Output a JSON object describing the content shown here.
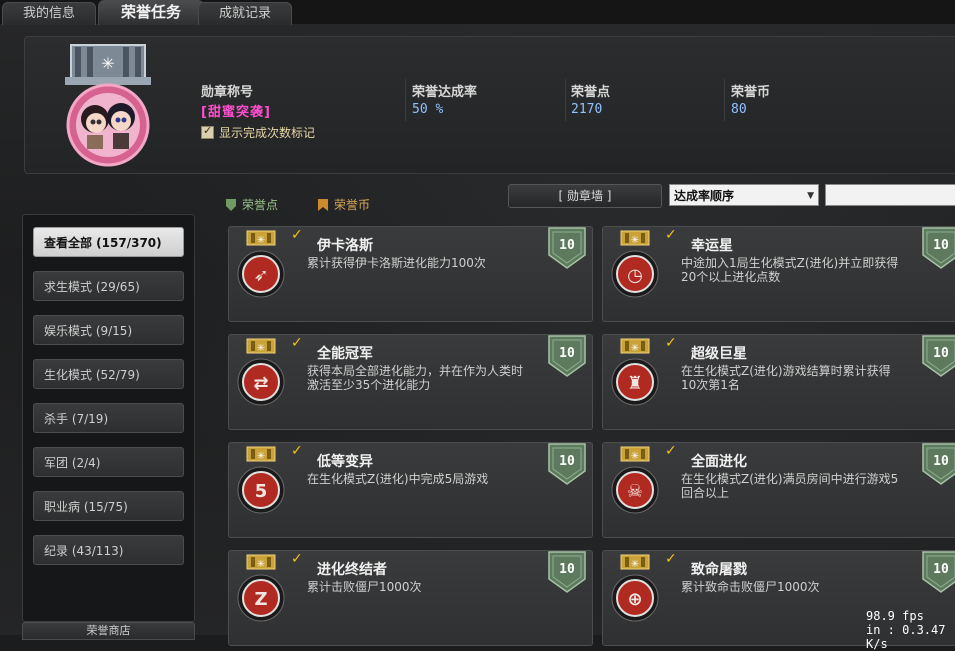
{
  "tabs": [
    {
      "label": "我的信息"
    },
    {
      "label": "荣誉任务"
    },
    {
      "label": "成就记录"
    }
  ],
  "profile": {
    "medal_title_label": "勋章称号",
    "medal_title_value": "[甜蜜突袭]",
    "completion_label": "荣誉达成率",
    "completion_value": "50 %",
    "honor_points_label": "荣誉点",
    "honor_points_value": "2170",
    "honor_coins_label": "荣誉币",
    "honor_coins_value": "80",
    "show_count_label": "显示完成次数标记",
    "show_count_checked": true
  },
  "legend": {
    "honor_points": "荣誉点",
    "honor_coins": "荣誉币"
  },
  "controls": {
    "wall_button": "[ 勋章墙 ]",
    "sort_value": "达成率顺序"
  },
  "sidebar": {
    "items": [
      {
        "label": "查看全部 (157/370)"
      },
      {
        "label": "求生模式 (29/65)"
      },
      {
        "label": "娱乐模式 (9/15)"
      },
      {
        "label": "生化模式 (52/79)"
      },
      {
        "label": "杀手 (7/19)"
      },
      {
        "label": "军团 (2/4)"
      },
      {
        "label": "职业病 (15/75)"
      },
      {
        "label": "纪录 (43/113)"
      }
    ],
    "bottom_label": "荣誉商店"
  },
  "cards": [
    {
      "title": "伊卡洛斯",
      "desc": "累计获得伊卡洛斯进化能力100次",
      "points": "10",
      "icon": "wings-icon"
    },
    {
      "title": "幸运星",
      "desc": "中途加入1局生化模式Z(进化)并立即获得20个以上进化点数",
      "points": "10",
      "icon": "clock-icon"
    },
    {
      "title": "全能冠军",
      "desc": "获得本局全部进化能力，并在作为人类时激活至少35个进化能力",
      "points": "10",
      "icon": "swap-icon"
    },
    {
      "title": "超级巨星",
      "desc": "在生化模式Z(进化)游戏结算时累计获得10次第1名",
      "points": "10",
      "icon": "trophy-icon"
    },
    {
      "title": "低等变异",
      "desc": "在生化模式Z(进化)中完成5局游戏",
      "points": "10",
      "icon": "number-five-icon"
    },
    {
      "title": "全面进化",
      "desc": "在生化模式Z(进化)满员房间中进行游戏5回合以上",
      "points": "10",
      "icon": "skull-icon"
    },
    {
      "title": "进化终结者",
      "desc": "累计击败僵尸1000次",
      "points": "10",
      "icon": "zombie-z-icon"
    },
    {
      "title": "致命屠戮",
      "desc": "累计致命击败僵尸1000次",
      "points": "10",
      "icon": "target-icon"
    }
  ],
  "overlay": {
    "fps": "98.9 fps",
    "net": "in : 0.3.47 K/s"
  },
  "colors": {
    "title_pink": "#ff4fcf",
    "stat_blue": "#8fc2ff",
    "check_gold": "#f5c21b",
    "badge_green": "#5d7a5e",
    "medal_red": "#b02a22"
  }
}
